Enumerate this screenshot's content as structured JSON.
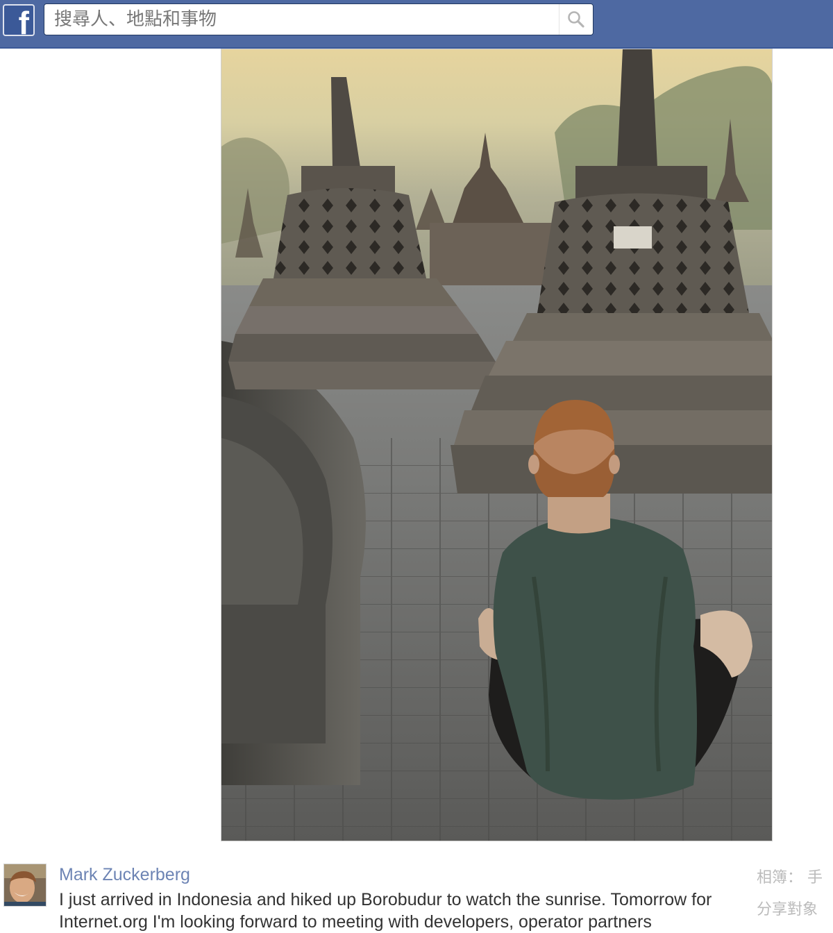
{
  "topbar": {
    "logo_letter": "f",
    "search": {
      "placeholder": "搜尋人、地點和事物"
    }
  },
  "icons": {
    "logo": "facebook-logo-icon",
    "search": "magnifier-icon"
  },
  "colors": {
    "topbar": "#4e69a2",
    "author_link": "#6d84b4",
    "side_text": "#bbbbbb"
  },
  "post": {
    "author": "Mark Zuckerberg",
    "text": "I just arrived in Indonesia and hiked up Borobudur to watch the sunrise. Tomorrow for Internet.org I'm looking forward to meeting with developers, operator partners"
  },
  "sidebar": {
    "related_label": "相簿：",
    "related_value": "手",
    "share_label": "分享對象"
  }
}
